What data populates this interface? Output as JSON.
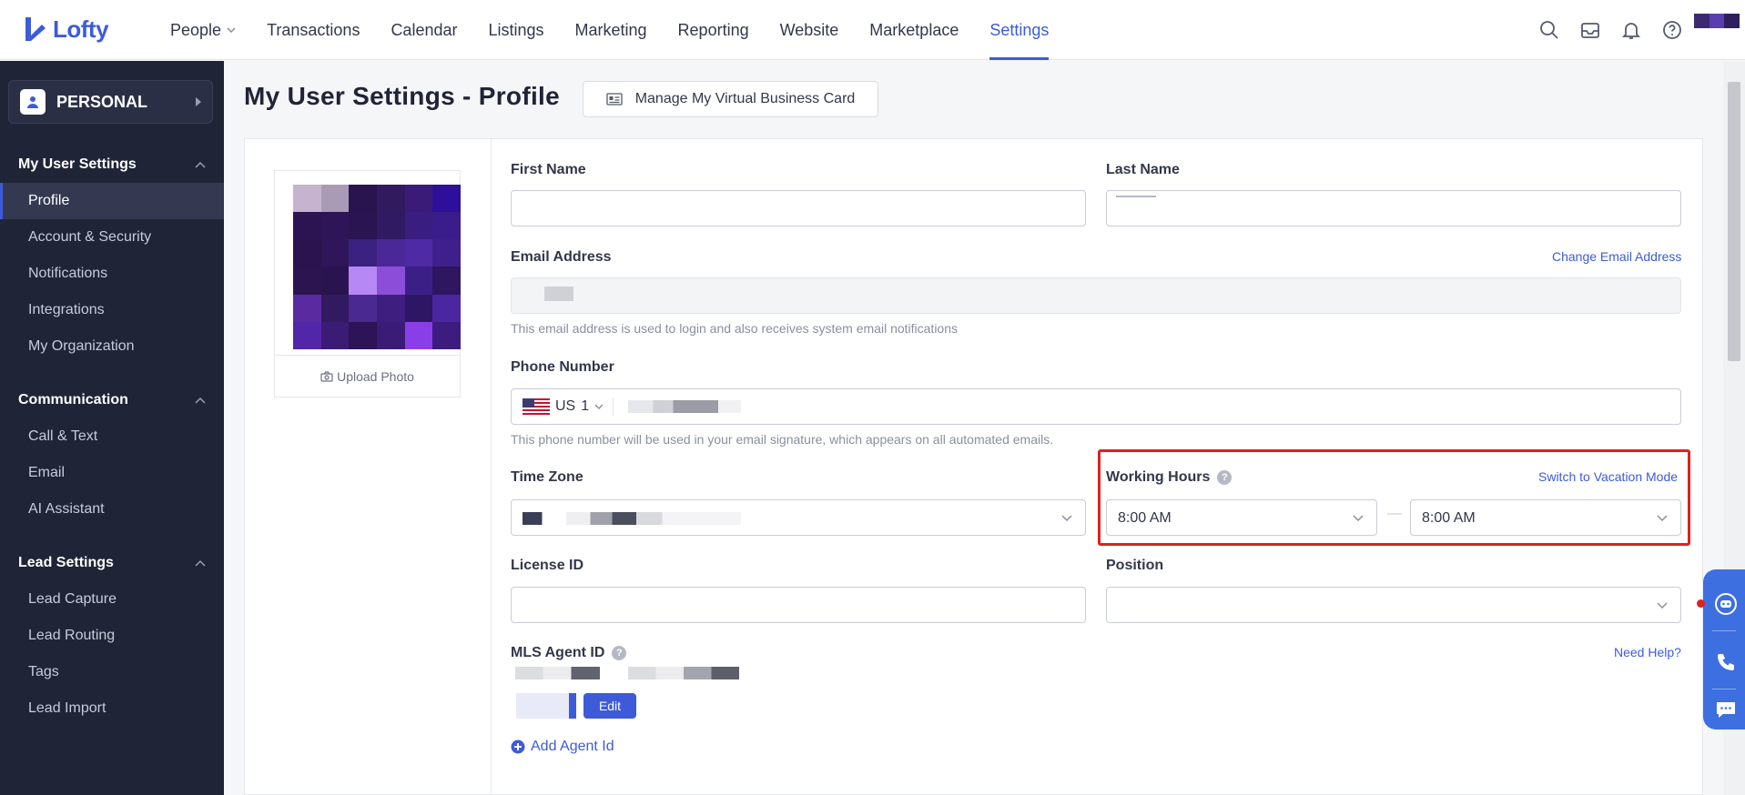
{
  "brand": {
    "name": "Lofty",
    "color": "#3d5bd9"
  },
  "topnav": {
    "items": [
      {
        "label": "People",
        "has_dropdown": true
      },
      {
        "label": "Transactions"
      },
      {
        "label": "Calendar"
      },
      {
        "label": "Listings"
      },
      {
        "label": "Marketing"
      },
      {
        "label": "Reporting"
      },
      {
        "label": "Website"
      },
      {
        "label": "Marketplace"
      },
      {
        "label": "Settings",
        "active": true
      }
    ],
    "icons": [
      "search-icon",
      "inbox-icon",
      "bell-icon",
      "help-icon"
    ]
  },
  "sidebar": {
    "personal_label": "PERSONAL",
    "sections": [
      {
        "title": "My User Settings",
        "items": [
          "Profile",
          "Account & Security",
          "Notifications",
          "Integrations",
          "My Organization"
        ],
        "active": "Profile"
      },
      {
        "title": "Communication",
        "items": [
          "Call & Text",
          "Email",
          "AI Assistant"
        ]
      },
      {
        "title": "Lead Settings",
        "items": [
          "Lead Capture",
          "Lead Routing",
          "Tags",
          "Lead Import"
        ]
      }
    ]
  },
  "page": {
    "title": "My User Settings - Profile",
    "vbc_button": "Manage My Virtual Business Card"
  },
  "photo": {
    "upload_label": "Upload Photo"
  },
  "form": {
    "first_name": {
      "label": "First Name",
      "value": ""
    },
    "last_name": {
      "label": "Last Name"
    },
    "email": {
      "label": "Email Address",
      "change_link": "Change Email Address",
      "hint": "This email address is used to login and also receives system email notifications"
    },
    "phone": {
      "label": "Phone Number",
      "country": "US",
      "code": "1",
      "hint": "This phone number will be used in your email signature, which appears on all automated emails."
    },
    "time_zone": {
      "label": "Time Zone"
    },
    "working_hours": {
      "label": "Working Hours",
      "vacation_link": "Switch to Vacation Mode",
      "start": "8:00 AM",
      "separator": "—",
      "end": "8:00 AM"
    },
    "license_id": {
      "label": "License ID",
      "value": ""
    },
    "position": {
      "label": "Position",
      "value": ""
    },
    "mls_agent_id": {
      "label": "MLS Agent ID",
      "help_link": "Need Help?",
      "edit_label": "Edit",
      "add_label": "Add Agent Id"
    }
  }
}
